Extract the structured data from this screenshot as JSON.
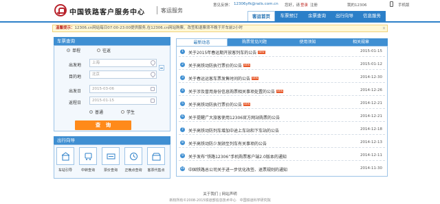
{
  "header": {
    "site_title": "中国铁路客户服务中心",
    "site_sub": "客运服务",
    "feedback_label": "意见反馈：",
    "feedback_email": "12306yfk@rails.com.cn",
    "welcome": "您好，请",
    "login": "登录",
    "register": "注册",
    "phone_label": "我的12306",
    "mobile_label": "手机版"
  },
  "nav": {
    "items": [
      {
        "label": "客运首页",
        "active": true
      },
      {
        "label": "车票预订",
        "active": false
      },
      {
        "label": "余票查询",
        "active": false
      },
      {
        "label": "出行向导",
        "active": false
      },
      {
        "label": "信息服务",
        "active": false
      }
    ]
  },
  "notice": {
    "label": "温馨提示：",
    "text": "12306.cn网站每日07:00-23:00提供服务,在12306.cn网站购票、改签和退票须不晚于开车前2小时"
  },
  "ticket_search": {
    "title": "车票查询",
    "trip_oneway": "单程",
    "trip_round": "往返",
    "from_label": "出发地",
    "from_value": "上海",
    "to_label": "目的地",
    "to_value": "北京",
    "depart_label": "出发日",
    "depart_value": "2015-03-06",
    "return_label": "返程日",
    "return_value": "2015-01-15",
    "type_normal": "普通",
    "type_student": "学生",
    "search_button": "查　询"
  },
  "guide": {
    "title": "出行向导",
    "items": [
      {
        "label": "车站引导",
        "icon": "station-guide-icon"
      },
      {
        "label": "中转查询",
        "icon": "transfer-icon"
      },
      {
        "label": "票价查询",
        "icon": "fare-icon"
      },
      {
        "label": "正晚点查询",
        "icon": "clock-icon"
      },
      {
        "label": "客票代售点",
        "icon": "agency-icon"
      }
    ]
  },
  "news": {
    "tabs": [
      {
        "label": "最新动态",
        "active": true
      },
      {
        "label": "购票常见问题",
        "active": false
      },
      {
        "label": "使用须知",
        "active": false
      },
      {
        "label": "相关规章",
        "active": false
      }
    ],
    "rows": [
      {
        "num": "1",
        "title": "关于2015年春运期开放客列车的公告",
        "new": true,
        "date": "2015-01-15"
      },
      {
        "num": "2",
        "title": "关于高铁动防执行票价的公告",
        "new": true,
        "date": "2015-01-12"
      },
      {
        "num": "3",
        "title": "关于春运运客车票发售时间的公告",
        "new": true,
        "date": "2014-12-30"
      },
      {
        "num": "4",
        "title": "关于涉及冒用身份信息购票相关事项处置的公告",
        "new": true,
        "date": "2014-12-26"
      },
      {
        "num": "5",
        "title": "关于高铁动防执行票价的公告",
        "new": true,
        "date": "2014-12-21"
      },
      {
        "num": "6",
        "title": "关于提醒广大旅客使用12306官方网站购票的公告",
        "new": false,
        "date": "2014-12-21"
      },
      {
        "num": "7",
        "title": "关于高铁动防列车增加中途上车站和下车站的公告",
        "new": false,
        "date": "2014-12-18"
      },
      {
        "num": "8",
        "title": "关于高铁动防少发顾至列车有关事项的公告",
        "new": false,
        "date": "2014-12-13"
      },
      {
        "num": "9",
        "title": "关于发布“铁路12306”手机购票客户端2.0版本的通知",
        "new": false,
        "date": "2014-12-11"
      },
      {
        "num": "10",
        "title": "中国铁路总公司关于进一步优化改签、退票规则的通知",
        "new": false,
        "date": "2014-11-30"
      }
    ]
  },
  "footer": {
    "about": "关于我们",
    "statement": "网站声明",
    "copyright": "新权所有©2008-2015铁道部信息技术中心　中国铁道科学研究院"
  },
  "colors": {
    "brand_red": "#b8222b",
    "nav_blue": "#2b7fc8",
    "accent_orange": "#ff8a1a"
  }
}
